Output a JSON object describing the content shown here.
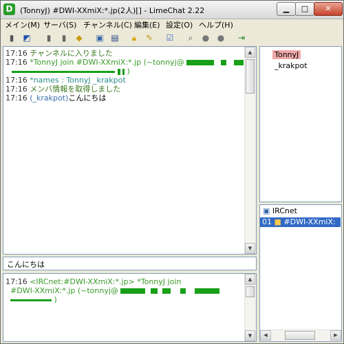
{
  "window": {
    "title": "(TonnyJ) #DWI-XXmiX:*.jp(2人)[] - LimeChat 2.22",
    "app_icon": "D"
  },
  "menu": [
    {
      "label": "メイン(M)"
    },
    {
      "label": "サーバ(S)"
    },
    {
      "label": "チャンネル(C)"
    },
    {
      "label": "編集(E)"
    },
    {
      "label": "設定(O)"
    },
    {
      "label": "ヘルプ(H)"
    }
  ],
  "toolbar_icons": [
    "connect-icon",
    "disconnect-icon",
    "server-list-icon",
    "server-properties-icon",
    "join-icon",
    "leave-icon",
    "channel-list-icon",
    "channel-properties-icon",
    "lock-icon",
    "edit-icon",
    "checklist-icon",
    "search-icon",
    "speech-icon",
    "mute-icon",
    "exit-icon"
  ],
  "log": {
    "line1": {
      "time": "17:16",
      "text": "チャンネルに入りました"
    },
    "line2": {
      "time": "17:16",
      "text": "*TonnyJ join #DWI-XXmiX:*.jp (~tonnyj@"
    },
    "line2_end": ")",
    "line3": {
      "time": "17:16",
      "text": "*names : TonnyJ _krakpot"
    },
    "line4": {
      "time": "17:16",
      "text": "メンバ情報を取得しました"
    },
    "line5": {
      "time": "17:16",
      "nick": "(_krakpot)",
      "text": "こんにちは"
    }
  },
  "input": {
    "value": "こんにちは"
  },
  "console": {
    "line1": {
      "time": "17:16",
      "text": "<IRCnet:#DWI-XXmiX:*.jp> *TonnyJ join"
    },
    "line2": {
      "text": "#DWI-XXmiX:*.jp (~tonnyj@"
    },
    "line3_end": ")"
  },
  "members": [
    "TonnyJ",
    "_krakpot"
  ],
  "tree": {
    "server": "IRCnet",
    "channel_prefix": "01",
    "channel": "#DWI-XXmiX:"
  },
  "colors": {
    "time": "#333333",
    "system": "#3a7a1e",
    "join": "#3a9a2a",
    "names": "#2b8a8a",
    "self_highlight": "#f0a8a8",
    "tree_selected": "#316ac5",
    "redacted": "#18a018"
  }
}
